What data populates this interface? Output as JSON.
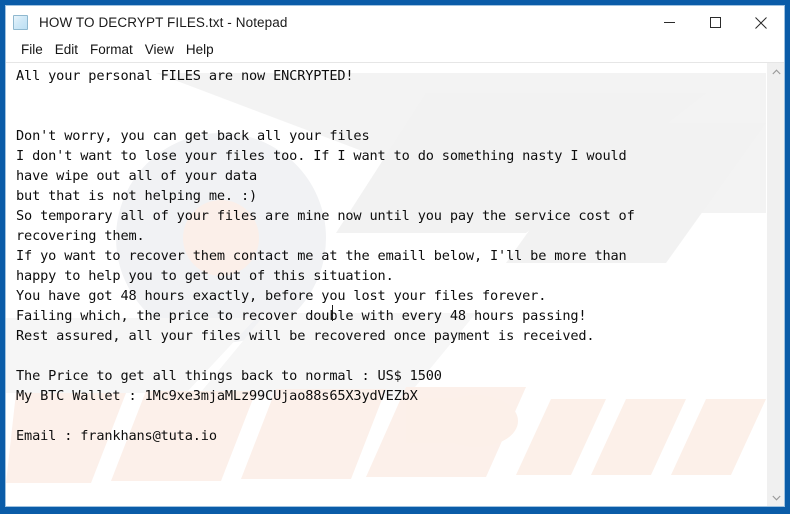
{
  "window": {
    "title": "HOW TO DECRYPT FILES.txt - Notepad",
    "app_icon": "notepad-icon",
    "border_color": "#0a5ca8",
    "controls": {
      "minimize": "minimize-icon",
      "maximize": "maximize-icon",
      "close": "close-icon"
    }
  },
  "menubar": {
    "items": [
      {
        "label": "File"
      },
      {
        "label": "Edit"
      },
      {
        "label": "Format"
      },
      {
        "label": "View"
      },
      {
        "label": "Help"
      }
    ]
  },
  "editor": {
    "content": "All your personal FILES are now ENCRYPTED!\n\n\nDon't worry, you can get back all your files\nI don't want to lose your files too. If I want to do something nasty I would\nhave wipe out all of your data\nbut that is not helping me. :)\nSo temporary all of your files are mine now until you pay the service cost of\nrecovering them.\nIf yo want to recover them contact me at the emaill below, I'll be more than\nhappy to help you to get out of this situation.\nYou have got 48 hours exactly, before you lost your files forever.\nFailing which, the price to recover double with every 48 hours passing!\nRest assured, all your files will be recovered once payment is received.\n\nThe Price to get all things back to normal : US$ 1500\nMy BTC Wallet : 1Mc9xe3mjaMLz99CUjao88s65X3ydVEZbX\n\nEmail : frankhans@tuta.io",
    "lines": [
      "All your personal FILES are now ENCRYPTED!",
      "",
      "",
      "Don't worry, you can get back all your files",
      "I don't want to lose your files too. If I want to do something nasty I would",
      "have wipe out all of your data",
      "but that is not helping me. :)",
      "So temporary all of your files are mine now until you pay the service cost of",
      "recovering them.",
      "If yo want to recover them contact me at the emaill below, I'll be more than",
      "happy to help you to get out of this situation.",
      "You have got 48 hours exactly, before you lost your files forever.",
      "Failing which, the price to recover double with every 48 hours passing!",
      "Rest assured, all your files will be recovered once payment is received.",
      "",
      "The Price to get all things back to normal : US$ 1500",
      "My BTC Wallet : 1Mc9xe3mjaMLz99CUjao88s65X3ydVEZbX",
      "",
      "Email : frankhans@tuta.io"
    ],
    "ransom_details": {
      "price": "US$ 1500",
      "btc_wallet": "1Mc9xe3mjaMLz99CUjao88s65X3ydVEZbX",
      "email": "frankhans@tuta.io",
      "deadline_hours": "48"
    },
    "text_color": "#0d0d0d",
    "background_color": "#ffffff",
    "caret_visible": true
  },
  "scrollbar": {
    "up_arrow": "chevron-up-icon",
    "down_arrow": "chevron-down-icon"
  },
  "watermark": {
    "text": ".com",
    "tint_gray": "#f1f1f1",
    "tint_pink": "#fcf0ea"
  }
}
